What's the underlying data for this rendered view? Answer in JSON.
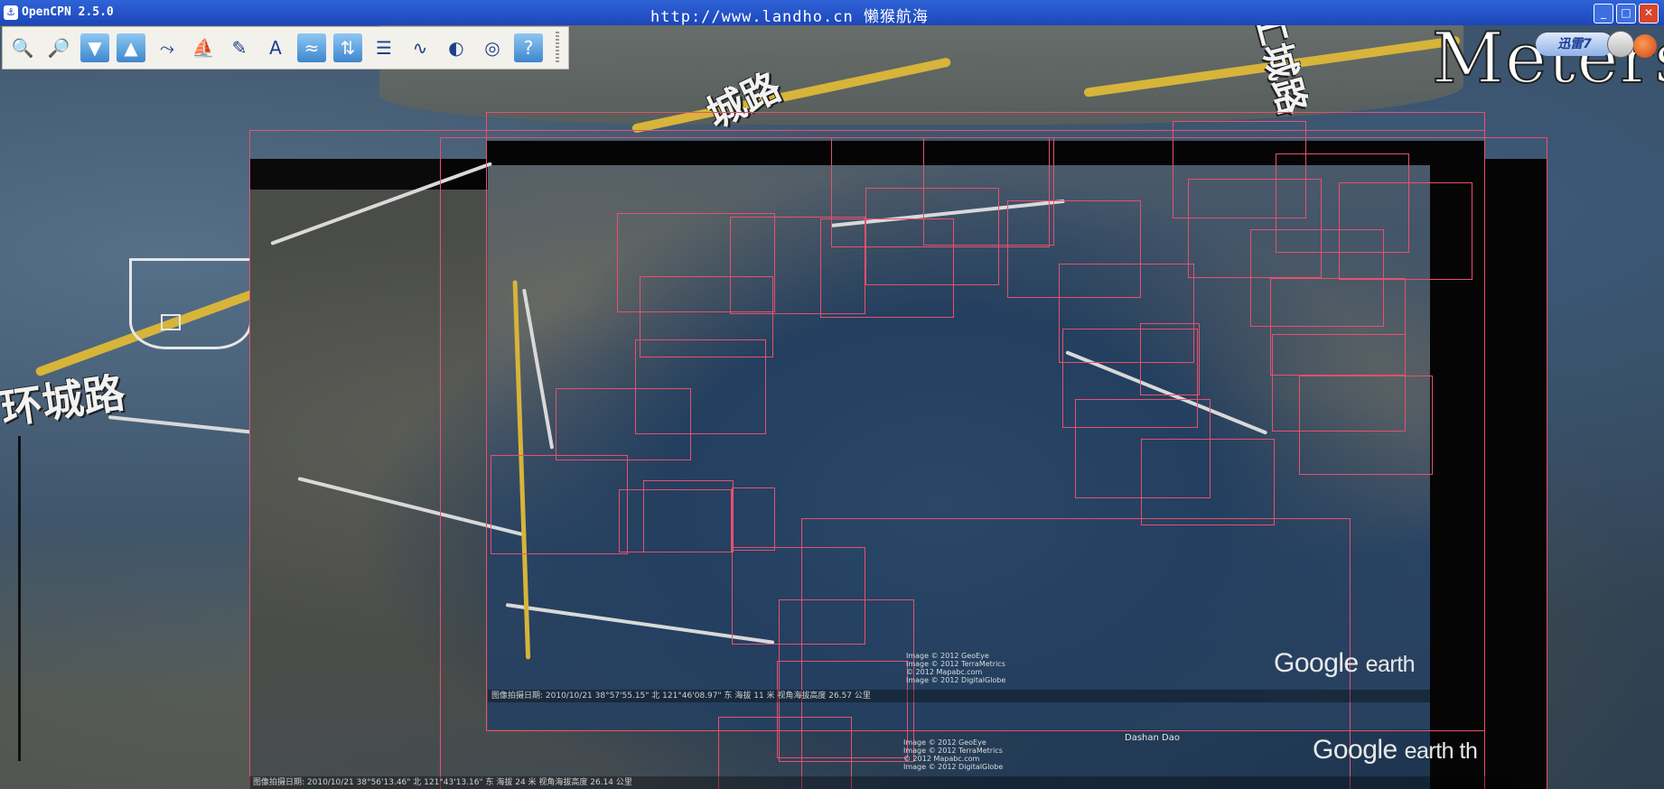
{
  "window": {
    "title": "OpenCPN 2.5.0",
    "banner": "http://www.landho.cn 懒猴航海",
    "buttons": {
      "minimize": "_",
      "maximize": "□",
      "close": "✕"
    }
  },
  "toolbar": {
    "tools": [
      {
        "name": "zoom-in-icon",
        "glyph": "🔍"
      },
      {
        "name": "zoom-out-icon",
        "glyph": "🔎"
      },
      {
        "name": "scale-in-icon",
        "glyph": "▼"
      },
      {
        "name": "scale-out-icon",
        "glyph": "▲"
      },
      {
        "name": "route-icon",
        "glyph": "⤳"
      },
      {
        "name": "auto-follow-icon",
        "glyph": "⛵"
      },
      {
        "name": "settings-icon",
        "glyph": "✎"
      },
      {
        "name": "text-icon",
        "glyph": "A"
      },
      {
        "name": "current-icon",
        "glyph": "≈"
      },
      {
        "name": "tide-icon",
        "glyph": "⇅"
      },
      {
        "name": "route-manager-icon",
        "glyph": "☰"
      },
      {
        "name": "track-icon",
        "glyph": "∿"
      },
      {
        "name": "color-scheme-icon",
        "glyph": "◐"
      },
      {
        "name": "mob-icon",
        "glyph": "◎"
      },
      {
        "name": "help-icon",
        "glyph": "?"
      }
    ]
  },
  "overlay": {
    "units_label": "Meters",
    "badge": "迅雷7"
  },
  "map": {
    "place_labels": [
      "城路",
      "环城路",
      "工城路"
    ]
  },
  "google_earth": {
    "logo_word": "Google",
    "logo_suffix": "earth",
    "logo2_suffix": "earth th",
    "status_line": "图像拍摄日期: 2010/10/21      38°57'55.15\" 北  121°46'08.97\" 东 海拔  11 米          视角海拔高度  26.57 公里",
    "status_line2": "图像拍摄日期: 2010/10/21      38°56'13.46\" 北  121°43'13.16\" 东 海拔  24 米          视角海拔高度  26.14 公里",
    "credits": "Image © 2012 GeoEye\nImage © 2012 TerraMetrics\n© 2012 Mapabc.com\nImage © 2012 DigitalGlobe",
    "sea_label": "Dashan Dao"
  },
  "colors": {
    "titlebar": "#1c46b8",
    "chart_outline": "#e8506e",
    "toolbar_bg": "#f2f1ec"
  }
}
